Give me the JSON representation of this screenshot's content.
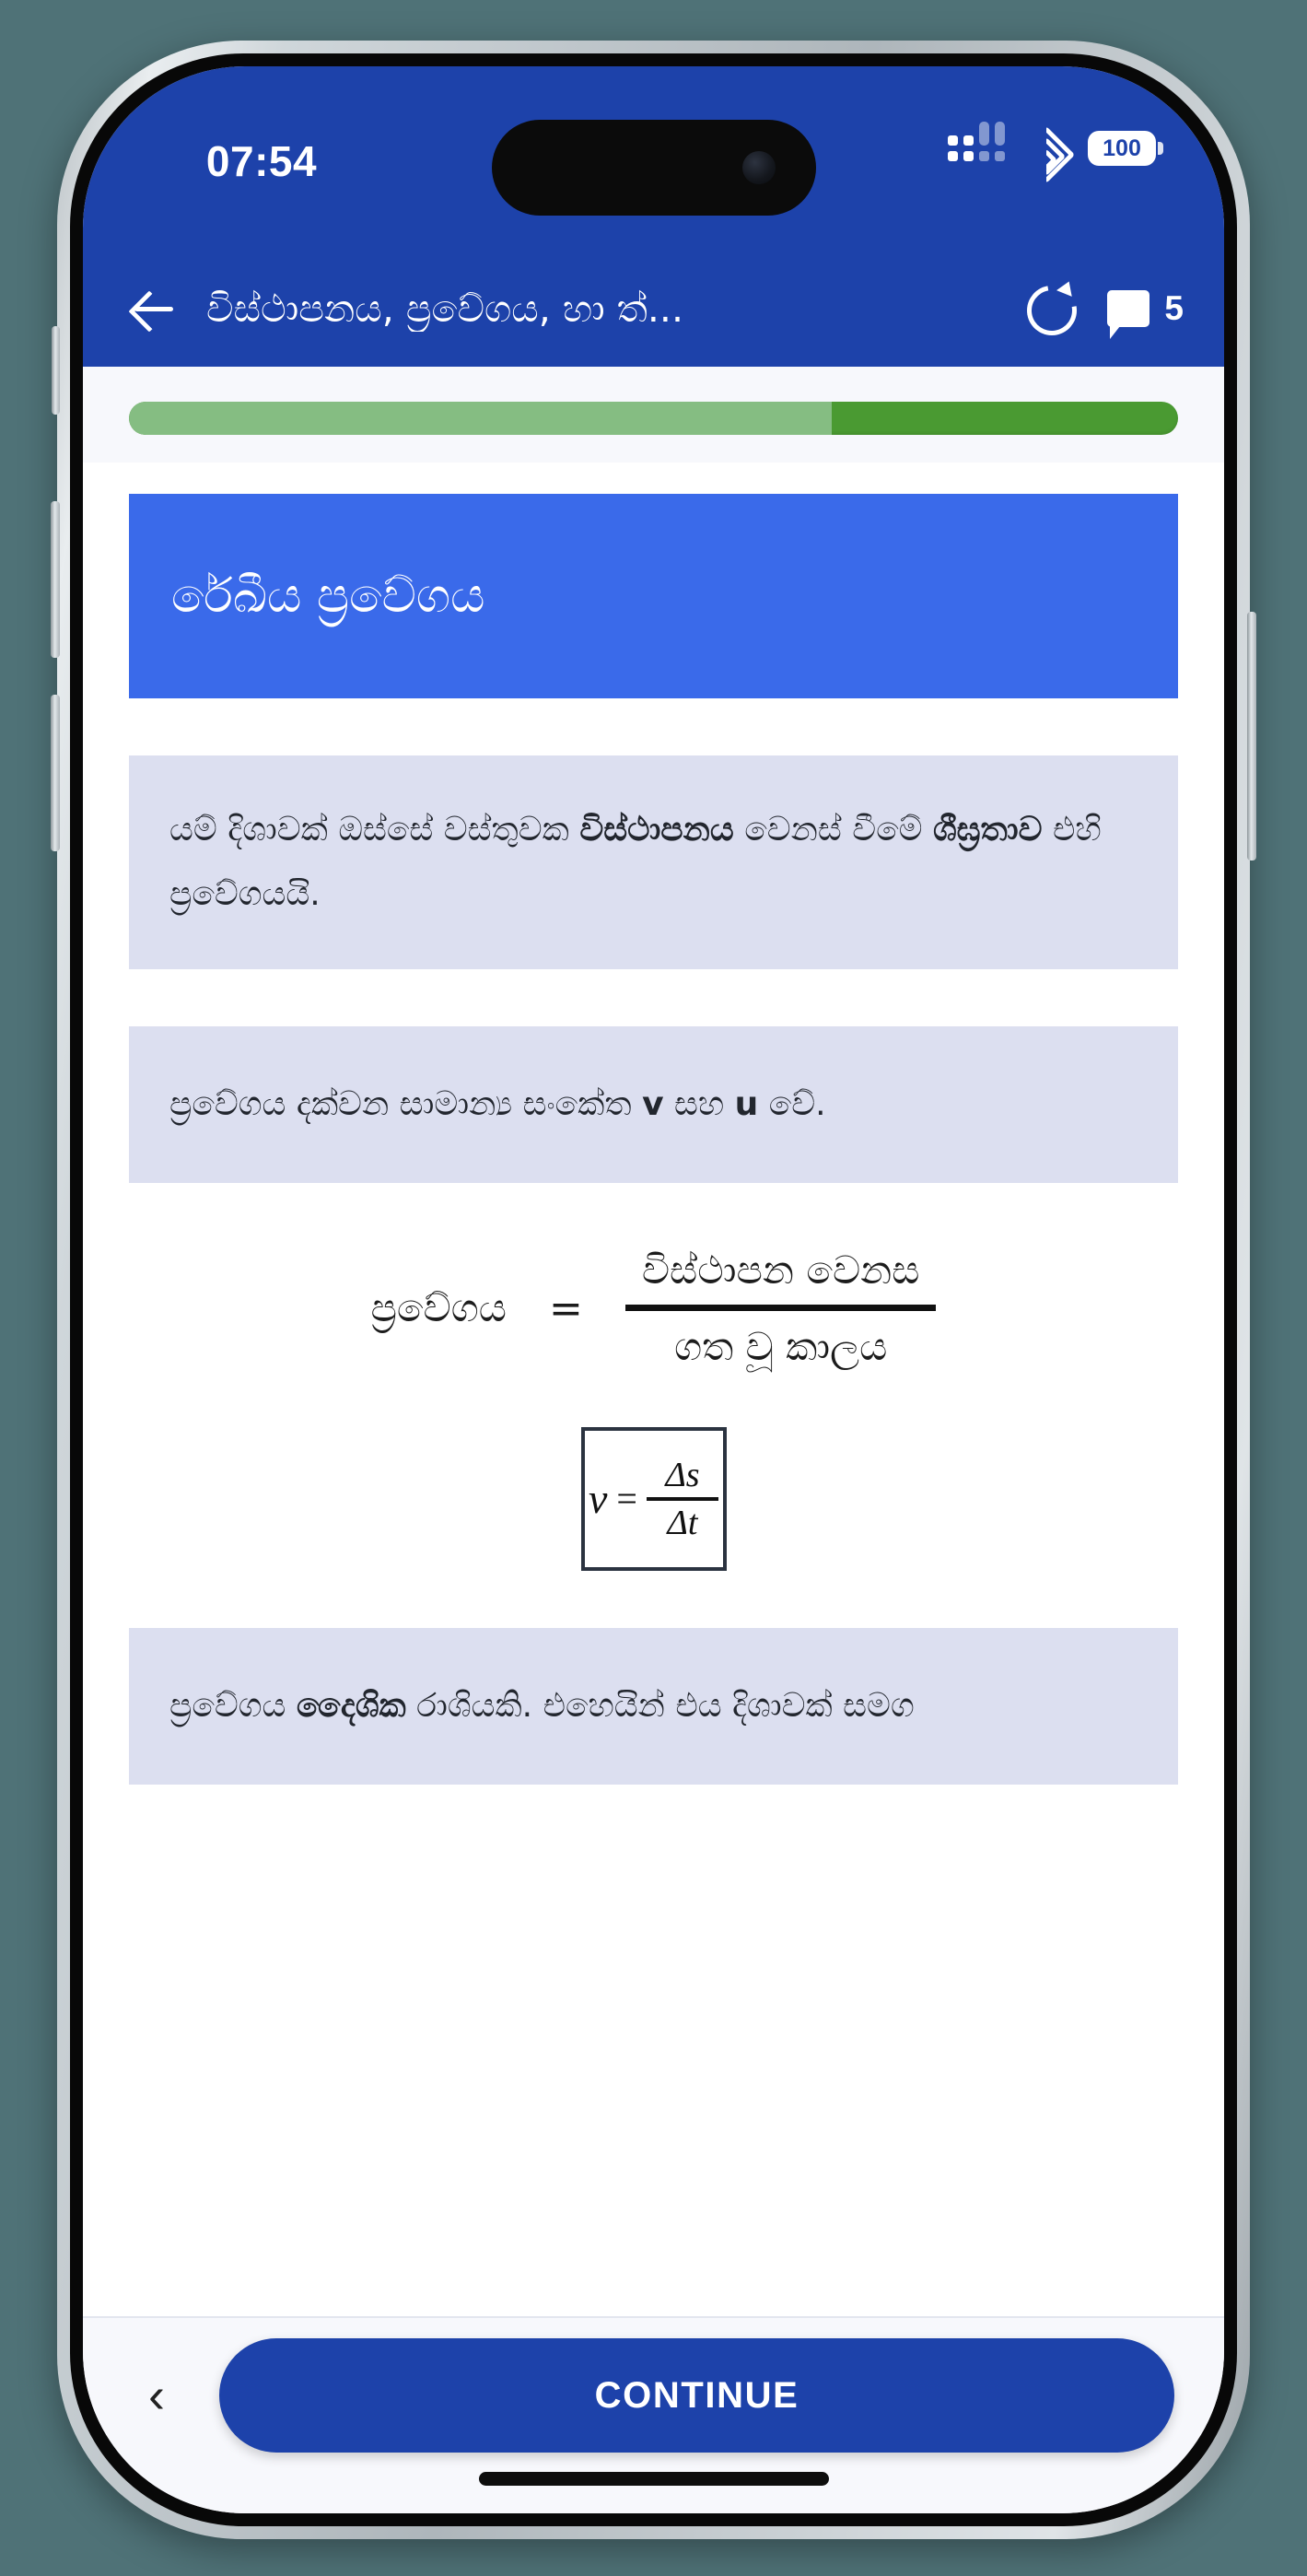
{
  "device": {
    "background_color": "#4f7277",
    "frame_color": "#c8cfd3"
  },
  "status_bar": {
    "time": "07:54",
    "background_color": "#1d42aa",
    "cellular_icon": "cellular-dots-icon",
    "wifi_icon": "wifi-icon",
    "battery_level": "100"
  },
  "app_bar": {
    "back_icon": "back-arrow-icon",
    "title": "විස්ථාපනය, ප්‍රවේගය, හා ත්...",
    "refresh_icon": "refresh-icon",
    "comment_icon": "comment-icon",
    "comment_count": "5",
    "background_color": "#1d42aa"
  },
  "progress": {
    "percent": 67,
    "fill_color": "#85bd82",
    "track_color": "#4a9a32"
  },
  "lesson": {
    "title_card": {
      "text": "රේඛීය ප්‍රවේගය",
      "background_color": "#3a6aea"
    },
    "block1": {
      "part1": "යම් දිශාවක් ඔස්සේ වස්තුවක ",
      "bold1": "විස්ථාපනය",
      "part2": " වෙනස් වීමේ ",
      "bold2": "ශීඝ්‍රතාව",
      "part3": " එහි ප්‍රවේගයයි."
    },
    "block2": {
      "part1": "ප්‍රවේගය දක්වන සාමාන්‍ය සංකේත ",
      "bold1": "v",
      "part2": " සහ ",
      "bold2": "u",
      "part3": " වේ."
    },
    "formula_words": {
      "lhs": "ප්‍රවේගය",
      "equals": "=",
      "numerator": "විස්ථාපන වෙනස",
      "denominator": "ගත වූ කාලය"
    },
    "formula_boxed": {
      "variable": "v",
      "equals": "=",
      "numerator": "Δs",
      "denominator": "Δt"
    },
    "block3": {
      "part1": "ප්‍රවේගය ",
      "bold1": "දෛශික",
      "part2": " රාශියකි. එහෙයින් එය දිශාවක් සමග"
    }
  },
  "bottom_bar": {
    "prev_icon": "chevron-left-icon",
    "continue_label": "CONTINUE",
    "continue_color": "#1d42aa"
  }
}
